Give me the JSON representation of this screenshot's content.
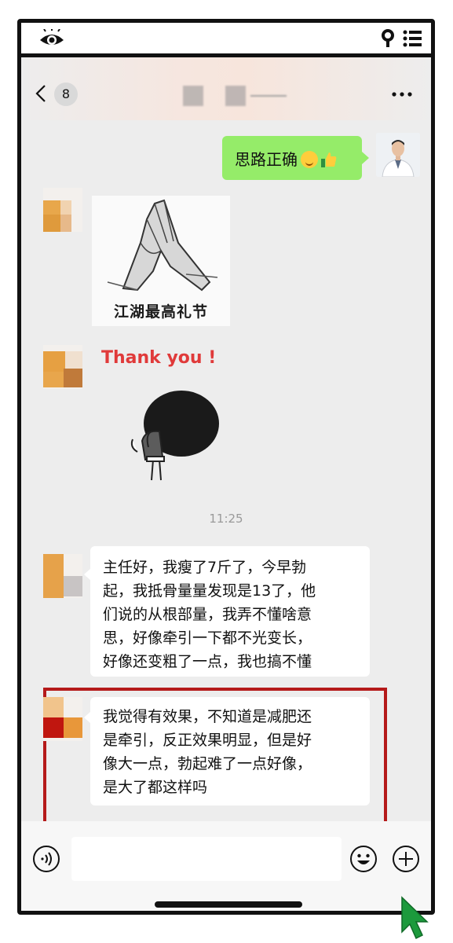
{
  "header": {
    "unread_count": "8"
  },
  "messages": {
    "sent_text": "思路正确",
    "sticker_caption": "江湖最高礼节",
    "thankyou": "Thank you !",
    "timestamp": "11:25",
    "recv1_lines": [
      "主任好，我瘦了7斤了，今早勃",
      "起，我抵骨量量发现是13了，他",
      "们说的从根部量，我弄不懂啥意",
      "思，好像牵引一下都不光变长，",
      "好像还变粗了一点，我也搞不懂"
    ],
    "recv2_lines": [
      "我觉得有效果，不知道是减肥还",
      "是牵引，反正效果明显，但是好",
      "像大一点，勃起难了一点好像，",
      "是大了都这样吗"
    ]
  },
  "colors": {
    "sent_bubble": "#95ec69",
    "highlight_border": "#b51a1a",
    "thankyou": "#e03a3a",
    "cursor": "#1c9a3c"
  },
  "icons": [
    "eye-icon",
    "search-icon",
    "menu-icon",
    "back-chevron-icon",
    "more-icon",
    "voice-icon",
    "emoji-icon",
    "plus-icon",
    "cursor-arrow-icon"
  ]
}
